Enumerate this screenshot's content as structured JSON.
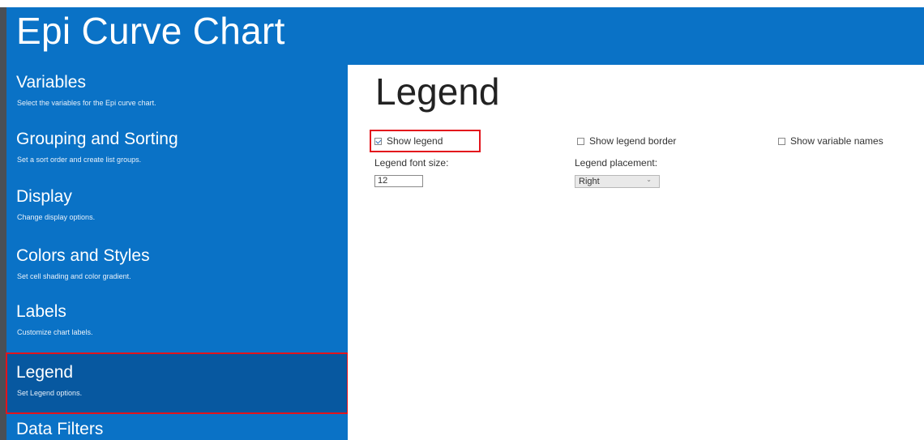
{
  "window": {
    "title": "Epi Curve Chart"
  },
  "sidebar": {
    "items": [
      {
        "label": "Variables",
        "description": "Select the variables for the Epi curve chart."
      },
      {
        "label": "Grouping and Sorting",
        "description": "Set a sort order and create list groups."
      },
      {
        "label": "Display",
        "description": "Change display options."
      },
      {
        "label": "Colors and Styles",
        "description": "Set cell shading and color gradient."
      },
      {
        "label": "Labels",
        "description": "Customize chart labels."
      },
      {
        "label": "Legend",
        "description": "Set Legend options.",
        "selected": true
      },
      {
        "label": "Data Filters",
        "description": ""
      }
    ]
  },
  "main": {
    "heading": "Legend",
    "show_legend": {
      "label": "Show legend",
      "checked": true
    },
    "show_legend_border": {
      "label": "Show legend border",
      "checked": false
    },
    "show_variable_names": {
      "label": "Show variable names",
      "checked": false
    },
    "font_size": {
      "label": "Legend font size:",
      "value": "12"
    },
    "placement": {
      "label": "Legend placement:",
      "value": "Right"
    }
  },
  "colors": {
    "panel_blue": "#0a72c6",
    "selected_blue": "#0758a0",
    "highlight_red": "#e3141c"
  },
  "icons": {
    "dropdown": "chevron-down-icon",
    "checkbox": "checkbox-icon"
  }
}
